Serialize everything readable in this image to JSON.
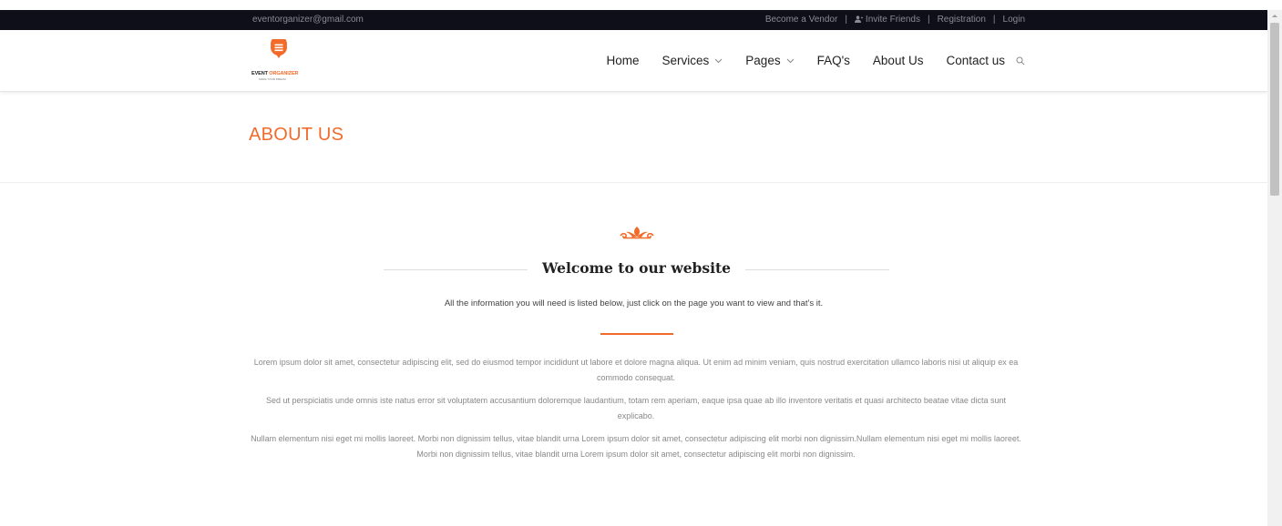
{
  "topbar": {
    "email": "eventorganizer@gmail.com",
    "links": [
      "Become a Vendor",
      "Invite Friends",
      "Registration",
      "Login"
    ]
  },
  "logo": {
    "brand_a": "EVENT",
    "brand_b": "ORGANIZER",
    "tagline": "MAKE YOUR DREAM"
  },
  "nav": {
    "items": [
      {
        "label": "Home"
      },
      {
        "label": "Services"
      },
      {
        "label": "Pages"
      },
      {
        "label": "FAQ's"
      },
      {
        "label": "About Us"
      },
      {
        "label": "Contact us"
      }
    ]
  },
  "page": {
    "title": "ABOUT US"
  },
  "main": {
    "heading": "Welcome to our website",
    "subtitle": "All the information you will need is listed below, just click on the page you want to view and that's it.",
    "paragraphs": [
      "Lorem ipsum dolor sit amet, consectetur adipiscing elit, sed do eiusmod tempor incididunt ut labore et dolore magna aliqua. Ut enim ad minim veniam, quis nostrud exercitation ullamco laboris nisi ut aliquip ex ea commodo consequat.",
      "Sed ut perspiciatis unde omnis iste natus error sit voluptatem accusantium doloremque laudantium, totam rem aperiam, eaque ipsa quae ab illo inventore veritatis et quasi architecto beatae vitae dicta sunt explicabo.",
      "Nullam elementum nisi eget mi mollis laoreet. Morbi non dignissim tellus, vitae blandit urna Lorem ipsum dolor sit amet, consectetur adipiscing elit morbi non dignissim.Nullam elementum nisi eget mi mollis laoreet. Morbi non dignissim tellus, vitae blandit urna Lorem ipsum dolor sit amet, consectetur adipiscing elit morbi non dignissim."
    ]
  },
  "colors": {
    "accent": "#f26b2a",
    "topbar": "#0f0f1a"
  },
  "icons": [
    "person-icon",
    "chevron-down-icon",
    "search-icon",
    "ornament-icon",
    "logo-pin-icon"
  ]
}
